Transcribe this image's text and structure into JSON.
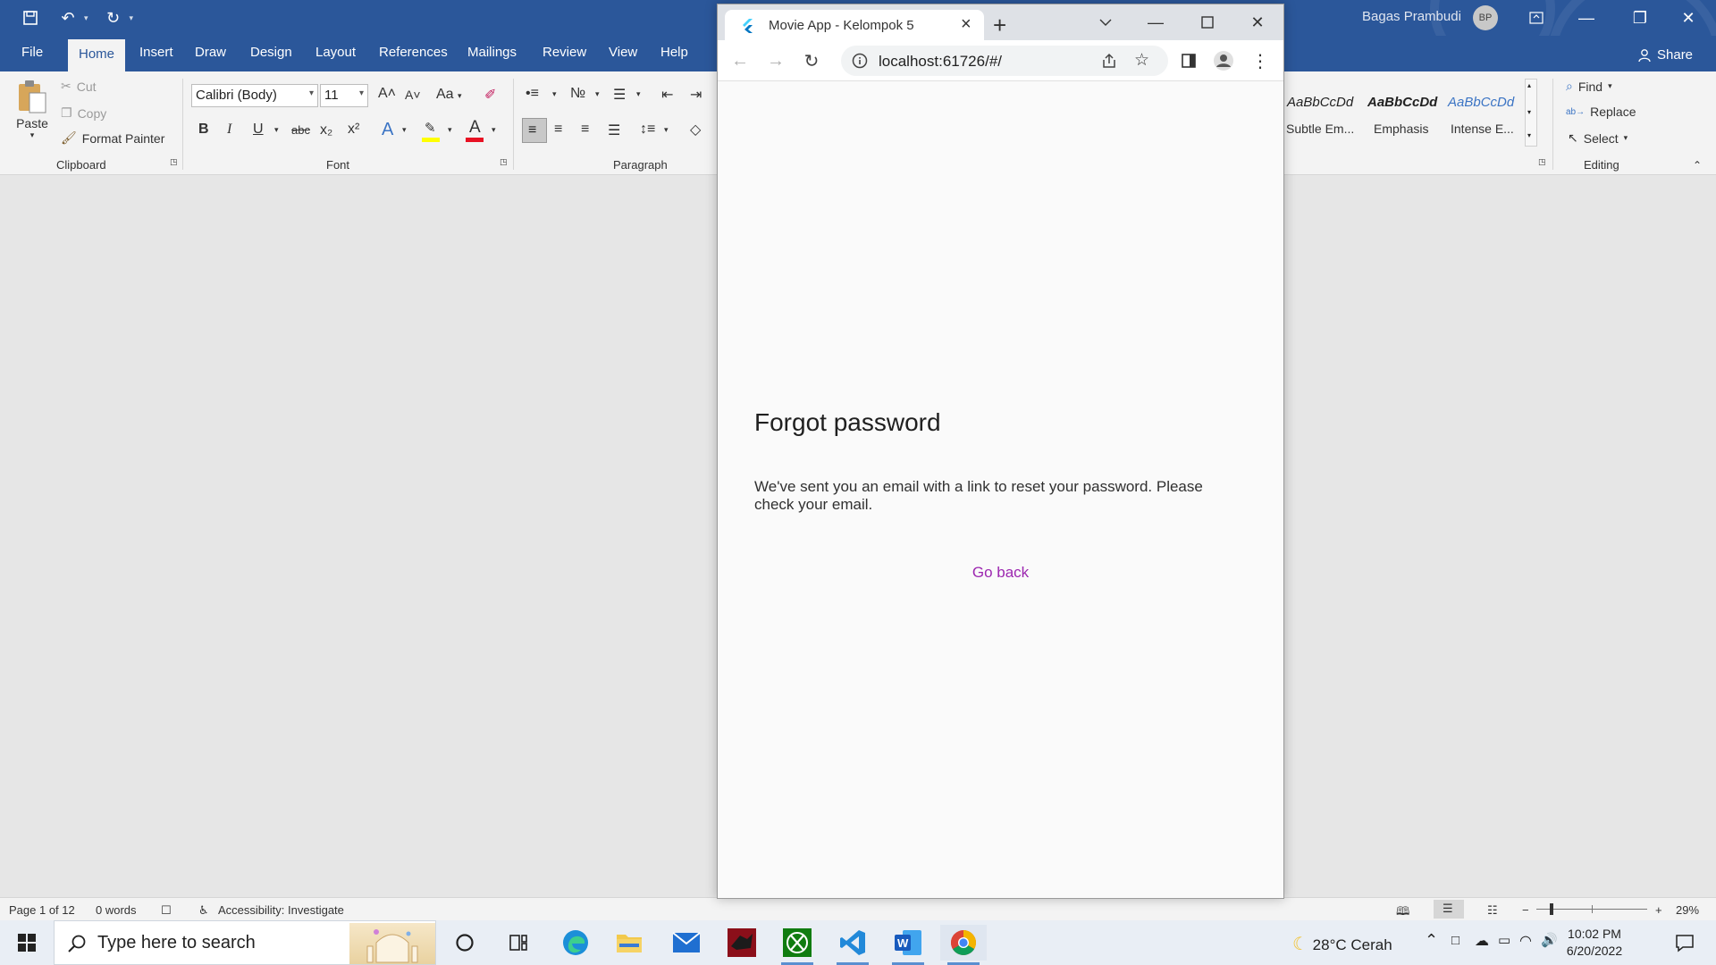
{
  "word": {
    "user_name": "Bagas Prambudi",
    "user_initials": "BP",
    "tabs": [
      "File",
      "Home",
      "Insert",
      "Draw",
      "Design",
      "Layout",
      "References",
      "Mailings",
      "Review",
      "View",
      "Help"
    ],
    "share_label": "Share",
    "ribbon": {
      "paste_label": "Paste",
      "cut_label": "Cut",
      "copy_label": "Copy",
      "format_painter_label": "Format Painter",
      "clipboard_group": "Clipboard",
      "font_name": "Calibri (Body)",
      "font_size": "11",
      "font_group": "Font",
      "paragraph_group": "Paragraph",
      "styles": [
        {
          "sample": "AaBbCcDd",
          "name": "Subtle Em..."
        },
        {
          "sample": "AaBbCcDd",
          "name": "Emphasis"
        },
        {
          "sample": "AaBbCcDd",
          "name": "Intense E..."
        }
      ],
      "find_label": "Find",
      "replace_label": "Replace",
      "select_label": "Select",
      "editing_group": "Editing",
      "change_case": "Aa",
      "font_color_glyph": "A",
      "strike": "abc",
      "subscript": "x₂",
      "superscript": "x²"
    },
    "status": {
      "page": "Page 1 of 12",
      "words": "0 words",
      "accessibility": "Accessibility: Investigate",
      "zoom": "29%"
    }
  },
  "browser": {
    "tab_title": "Movie App - Kelompok 5",
    "url": "localhost:61726/#/"
  },
  "app": {
    "title": "Forgot password",
    "message": "We've sent you an email with a link to reset your password. Please check your email.",
    "back_label": "Go back"
  },
  "taskbar": {
    "search_placeholder": "Type here to search",
    "weather": "28°C  Cerah",
    "time": "10:02 PM",
    "date": "6/20/2022"
  },
  "colors": {
    "word_blue": "#2b579a",
    "link_purple": "#9c27b0",
    "font_color_red": "#e81123",
    "highlight_yellow": "#ffff00"
  }
}
